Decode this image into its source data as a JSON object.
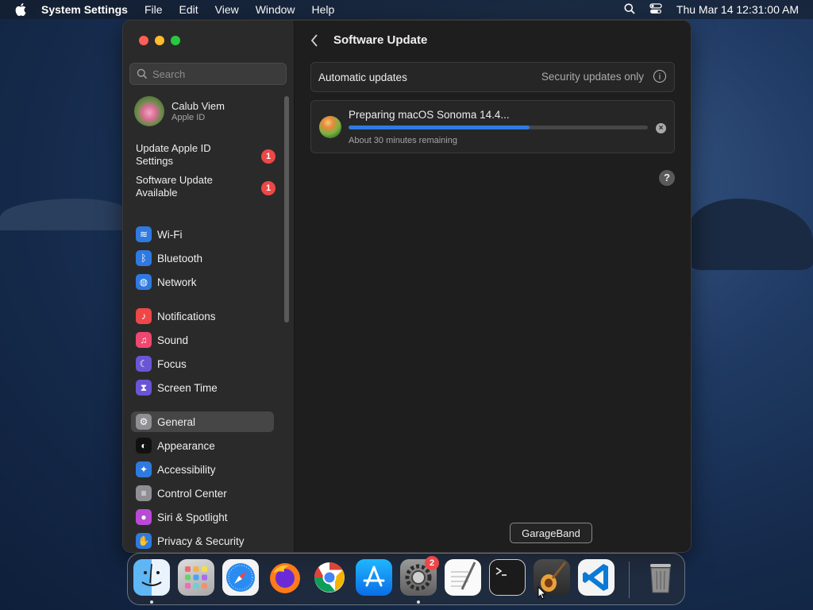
{
  "menubar": {
    "app_name": "System Settings",
    "menus": [
      "File",
      "Edit",
      "View",
      "Window",
      "Help"
    ],
    "datetime": "Thu Mar 14  12:31:00 AM"
  },
  "sidebar": {
    "search_placeholder": "Search",
    "profile": {
      "name": "Calub Viem",
      "subtitle": "Apple ID"
    },
    "notices": [
      {
        "label": "Update Apple ID Settings",
        "badge": "1"
      },
      {
        "label": "Software Update Available",
        "badge": "1"
      }
    ],
    "items": [
      {
        "label": "Wi-Fi",
        "icon": "wifi-icon",
        "color": "#2f7ae0"
      },
      {
        "label": "Bluetooth",
        "icon": "bluetooth-icon",
        "color": "#2f7ae0"
      },
      {
        "label": "Network",
        "icon": "globe-icon",
        "color": "#2f7ae0"
      },
      {
        "label": "Notifications",
        "icon": "bell-icon",
        "color": "#ee4747"
      },
      {
        "label": "Sound",
        "icon": "speaker-icon",
        "color": "#ee4770"
      },
      {
        "label": "Focus",
        "icon": "moon-icon",
        "color": "#6a55d6"
      },
      {
        "label": "Screen Time",
        "icon": "hourglass-icon",
        "color": "#6a55d6"
      },
      {
        "label": "General",
        "icon": "gear-icon",
        "color": "#8e8e93",
        "selected": true
      },
      {
        "label": "Appearance",
        "icon": "appearance-icon",
        "color": "#111111"
      },
      {
        "label": "Accessibility",
        "icon": "accessibility-icon",
        "color": "#2f7ae0"
      },
      {
        "label": "Control Center",
        "icon": "toggles-icon",
        "color": "#8e8e93"
      },
      {
        "label": "Siri & Spotlight",
        "icon": "siri-icon",
        "color": "#b84ad6"
      },
      {
        "label": "Privacy & Security",
        "icon": "hand-icon",
        "color": "#2f7ae0"
      }
    ]
  },
  "main": {
    "title": "Software Update",
    "automatic_label": "Automatic updates",
    "automatic_value": "Security updates only",
    "update": {
      "name": "Preparing macOS Sonoma 14.4...",
      "remaining": "About 30 minutes remaining",
      "progress": 0.605
    }
  },
  "tooltip": "GarageBand",
  "dock": {
    "apps": [
      "Finder",
      "Launchpad",
      "Safari",
      "Firefox",
      "Chrome",
      "App Store",
      "System Settings",
      "TextEdit",
      "Terminal",
      "GarageBand",
      "Visual Studio Code",
      "Trash"
    ],
    "settings_badge": "2"
  }
}
